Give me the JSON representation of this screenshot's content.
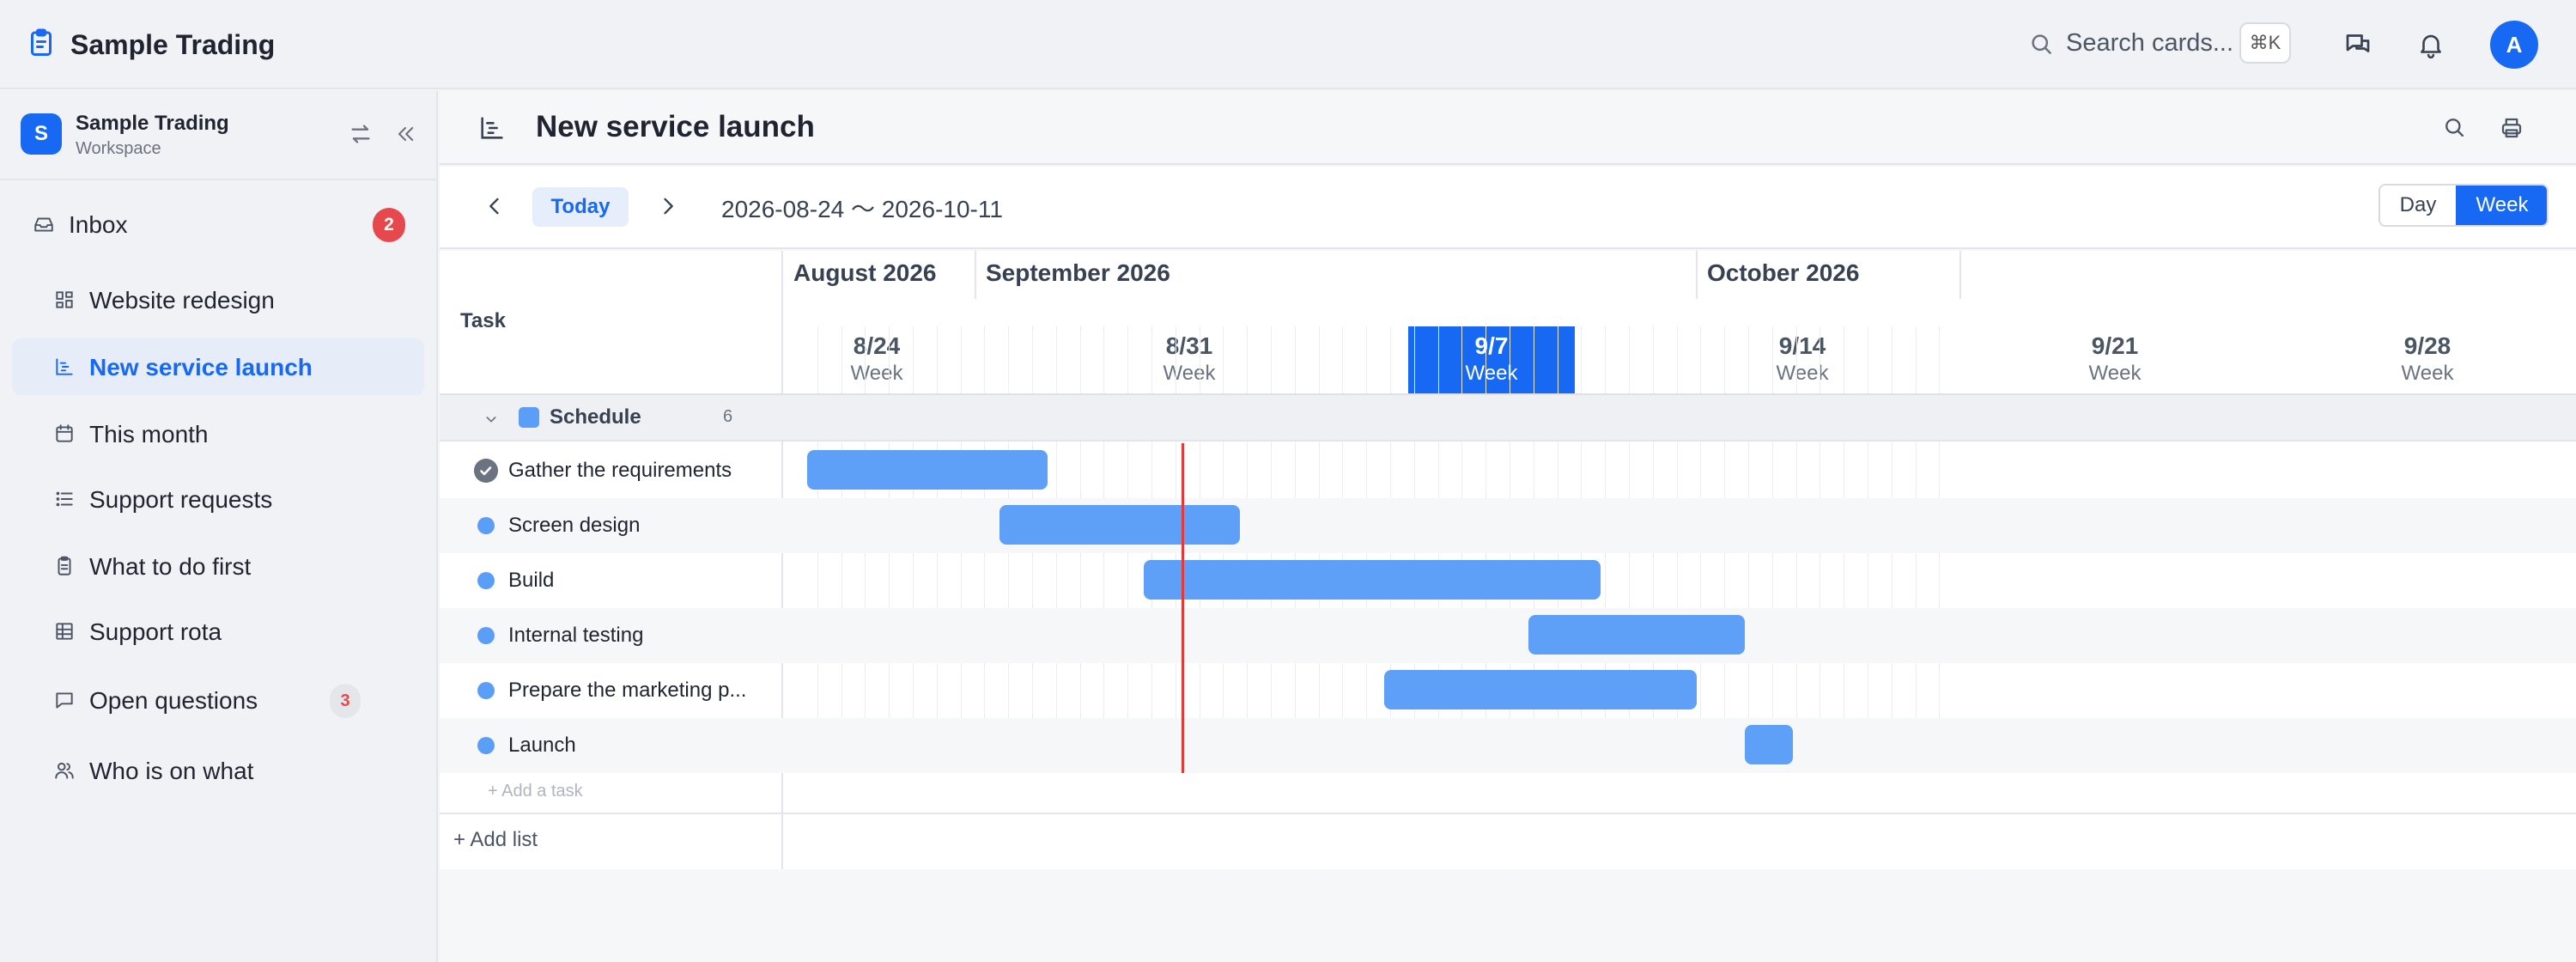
{
  "app": {
    "title": "Sample Trading",
    "search_placeholder": "Search cards...",
    "search_shortcut": "⌘K",
    "avatar_initial": "A"
  },
  "workspace": {
    "initial": "S",
    "name": "Sample Trading",
    "subtitle": "Workspace"
  },
  "sidebar": {
    "items": [
      {
        "label": "Inbox",
        "icon": "inbox-icon",
        "badge": "2"
      },
      {
        "label": "Website redesign",
        "icon": "board-icon"
      },
      {
        "label": "New service launch",
        "icon": "gantt-icon",
        "active": true
      },
      {
        "label": "This month",
        "icon": "calendar-icon"
      },
      {
        "label": "Support requests",
        "icon": "list-icon"
      },
      {
        "label": "What to do first",
        "icon": "clipboard-icon"
      },
      {
        "label": "Support rota",
        "icon": "table-icon"
      },
      {
        "label": "Open questions",
        "icon": "chat-icon",
        "badge": "3"
      },
      {
        "label": "Who is on what",
        "icon": "people-icon"
      }
    ]
  },
  "page": {
    "title": "New service launch"
  },
  "toolbar": {
    "today_label": "Today",
    "range": "2026-08-24 〜 2026-10-11",
    "view_day": "Day",
    "view_week": "Week",
    "active_view": "Week"
  },
  "gantt": {
    "task_header": "Task",
    "months": [
      "August 2026",
      "September 2026",
      "October 2026"
    ],
    "weeks": [
      {
        "date": "8/24",
        "label": "Week"
      },
      {
        "date": "8/31",
        "label": "Week"
      },
      {
        "date": "9/7",
        "label": "Week",
        "current": true
      },
      {
        "date": "9/14",
        "label": "Week"
      },
      {
        "date": "9/21",
        "label": "Week"
      },
      {
        "date": "9/28",
        "label": "Week"
      }
    ],
    "group": {
      "name": "Schedule",
      "count": "6"
    },
    "tasks": [
      {
        "name": "Gather the requirements",
        "done": true
      },
      {
        "name": "Screen design"
      },
      {
        "name": "Build"
      },
      {
        "name": "Internal testing"
      },
      {
        "name": "Prepare the marketing p..."
      },
      {
        "name": "Launch"
      }
    ],
    "add_task": "+ Add a task",
    "add_list": "+ Add list"
  },
  "colors": {
    "accent": "#1769f4",
    "bar": "#5e9ff7",
    "today_line": "#e53935",
    "badge_red": "#e5484d"
  }
}
